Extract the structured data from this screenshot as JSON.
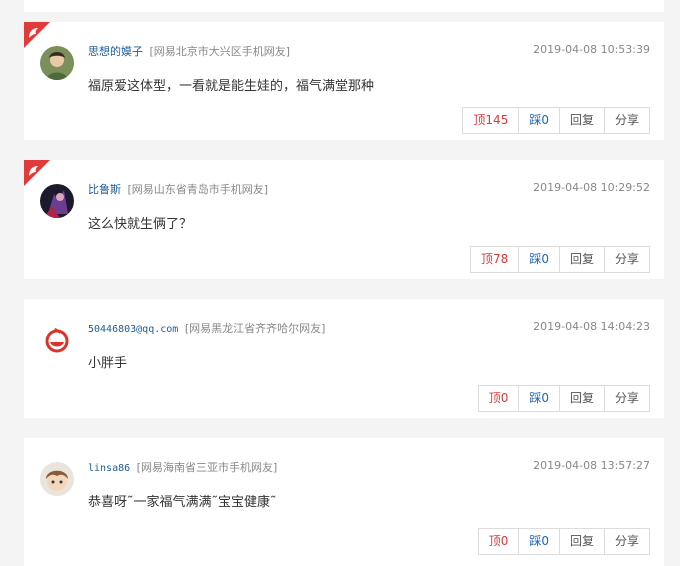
{
  "comments": [
    {
      "username": "思想的嫫子",
      "location": "[网易北京市大兴区手机网友]",
      "time": "2019-04-08 10:53:39",
      "content": "福原爱这体型，一看就是能生娃的，福气满堂那种",
      "up_label": "顶145",
      "down_label": "踩0",
      "reply_label": "回复",
      "share_label": "分享",
      "hot": true
    },
    {
      "username": "比鲁斯",
      "location": "[网易山东省青岛市手机网友]",
      "time": "2019-04-08 10:29:52",
      "content": "这么快就生俩了？",
      "up_label": "顶78",
      "down_label": "踩0",
      "reply_label": "回复",
      "share_label": "分享",
      "hot": true
    },
    {
      "username": "50446803@qq.com",
      "location": "[网易黑龙江省齐齐哈尔网友]",
      "time": "2019-04-08 14:04:23",
      "content": "小胖手",
      "up_label": "顶0",
      "down_label": "踩0",
      "reply_label": "回复",
      "share_label": "分享",
      "hot": false
    },
    {
      "username": "linsa86",
      "location": "[网易海南省三亚市手机网友]",
      "time": "2019-04-08 13:57:27",
      "content": "恭喜呀˜一家福气满满˜宝宝健康˜",
      "up_label": "顶0",
      "down_label": "踩0",
      "reply_label": "回复",
      "share_label": "分享",
      "hot": false
    }
  ],
  "colors": {
    "username": "#1f5d97",
    "up": "#d33c3c",
    "down": "#1f66b2",
    "hot_badge": "#e03a3a"
  },
  "icons": [
    "hot-badge-icon",
    "avatar"
  ]
}
